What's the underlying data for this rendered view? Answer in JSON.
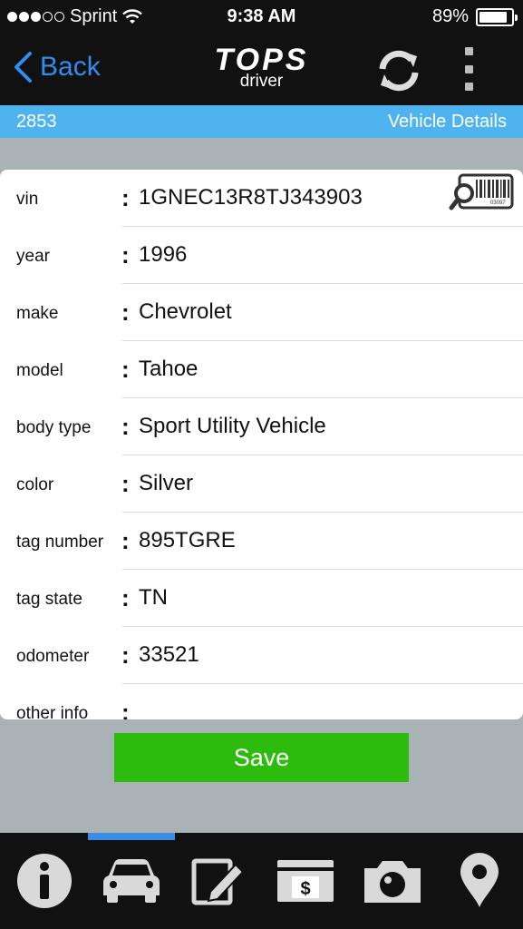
{
  "status_bar": {
    "carrier": "Sprint",
    "time": "9:38 AM",
    "battery_percent": "89%",
    "battery_level": 0.89,
    "signal_icon": "signal-dots-icon",
    "wifi_icon": "wifi-icon"
  },
  "nav": {
    "back_label": "Back",
    "logo_title": "TOPS",
    "logo_subtitle": "driver",
    "refresh_icon": "refresh-icon",
    "menu_icon": "kebab-menu-icon"
  },
  "subheader": {
    "record_id": "2853",
    "title": "Vehicle Details"
  },
  "fields": [
    {
      "label": "vin",
      "value": "1GNEC13R8TJ343903"
    },
    {
      "label": "year",
      "value": "1996"
    },
    {
      "label": "make",
      "value": "Chevrolet"
    },
    {
      "label": "model",
      "value": "Tahoe"
    },
    {
      "label": "body type",
      "value": "Sport Utility Vehicle"
    },
    {
      "label": "color",
      "value": "Silver"
    },
    {
      "label": "tag number",
      "value": "895TGRE"
    },
    {
      "label": "tag state",
      "value": "TN"
    },
    {
      "label": "odometer",
      "value": "33521"
    },
    {
      "label": "other info",
      "value": ""
    }
  ],
  "separator": ":",
  "barcode_text": "03097",
  "save_label": "Save",
  "tabs": [
    {
      "name": "info",
      "icon": "info-icon",
      "active": false
    },
    {
      "name": "vehicle",
      "icon": "car-icon",
      "active": true
    },
    {
      "name": "notes",
      "icon": "edit-icon",
      "active": false
    },
    {
      "name": "payment",
      "icon": "dollar-icon",
      "active": false
    },
    {
      "name": "photos",
      "icon": "camera-icon",
      "active": false
    },
    {
      "name": "location",
      "icon": "location-pin-icon",
      "active": false
    }
  ],
  "colors": {
    "accent_blue": "#2f8ef0",
    "subheader_blue": "#4fb3f0",
    "save_green": "#2dbb0e",
    "background_gray": "#a9b3b5",
    "bar_black": "#111111"
  }
}
